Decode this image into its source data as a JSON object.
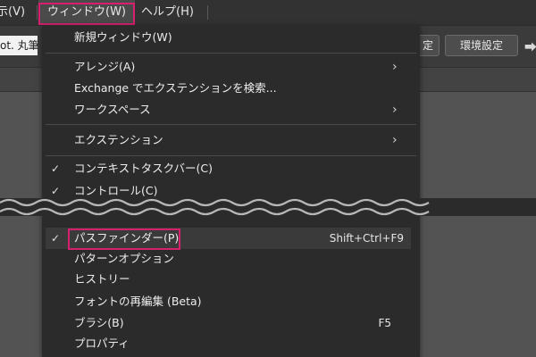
{
  "menubar": {
    "items": [
      {
        "label": "示(V)"
      },
      {
        "label": "ウィンドウ(W)"
      },
      {
        "label": "ヘルプ(H)"
      }
    ]
  },
  "controlbar": {
    "font_value": "ot. 丸筆",
    "partial_button": "定",
    "prefs_button": "環境設定",
    "arrow_glyph": "⮕"
  },
  "menu": {
    "items": [
      {
        "label": "新規ウィンドウ(W)"
      },
      {
        "label": "アレンジ(A)",
        "arrow": "›"
      },
      {
        "label": "Exchange でエクステンションを検索..."
      },
      {
        "label": "ワークスペース",
        "arrow": "›"
      },
      {
        "label": "エクステンション",
        "arrow": "›"
      },
      {
        "label": "コンテキストタスクバー(C)",
        "check": "✓"
      },
      {
        "label": "コントロール(C)",
        "check": "✓"
      },
      {
        "label": "パスファインダー(P)",
        "check": "✓",
        "shortcut": "Shift+Ctrl+F9"
      },
      {
        "label": "パターンオプション"
      },
      {
        "label": "ヒストリー"
      },
      {
        "label": "フォントの再編集 (Beta)"
      },
      {
        "label": "ブラシ(B)",
        "shortcut": "F5"
      },
      {
        "label": "プロパティ"
      }
    ]
  },
  "colors": {
    "highlight_border": "#d6206e",
    "menu_bg": "#2b2b2b",
    "menubar_bg": "#323232",
    "canvas_bg": "#535353",
    "hover_bg": "#3a3a3a"
  }
}
